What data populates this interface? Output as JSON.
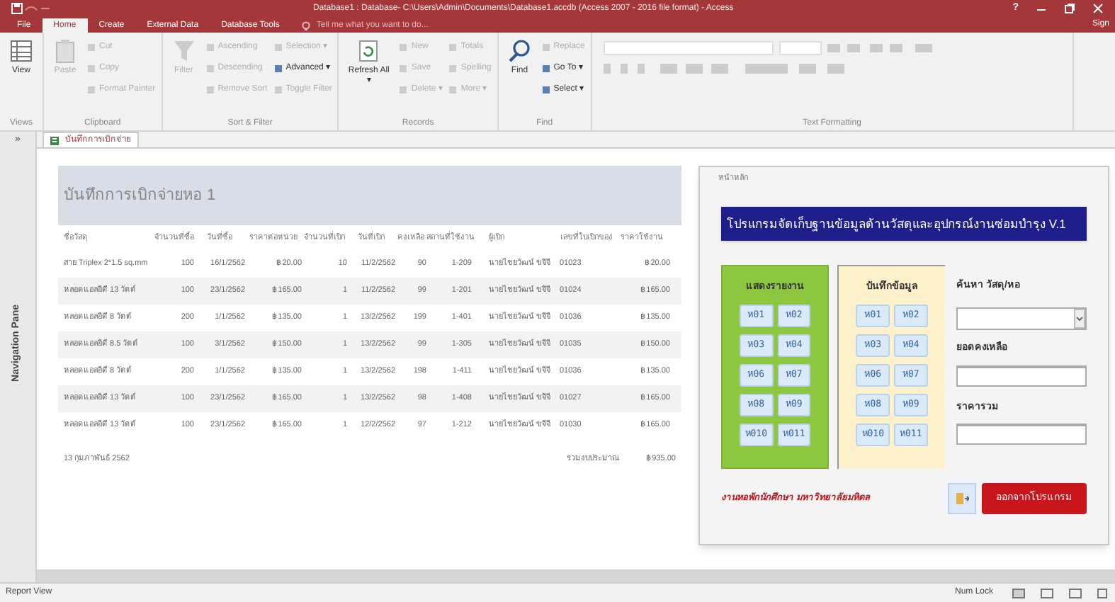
{
  "window": {
    "title": "Database1 : Database- C:\\Users\\Admin\\Documents\\Database1.accdb (Access 2007 - 2016 file format) - Access",
    "help": "?",
    "account": "Sign"
  },
  "ribbon_tabs": [
    {
      "label": "File",
      "selected": false
    },
    {
      "label": "Home",
      "selected": true
    },
    {
      "label": "Create",
      "selected": false
    },
    {
      "label": "External Data",
      "selected": false
    },
    {
      "label": "Database Tools",
      "selected": false
    }
  ],
  "tell_me": {
    "placeholder": "Tell me what you want to do..."
  },
  "ribbon_groups": [
    {
      "label": "Views",
      "columns": [
        [
          {
            "label": "View",
            "kind": "large",
            "disabled": false
          }
        ]
      ]
    },
    {
      "label": "Clipboard",
      "columns": [
        [
          {
            "label": "Paste",
            "kind": "large",
            "disabled": true
          }
        ],
        [
          {
            "label": "Cut",
            "kind": "small",
            "disabled": true
          },
          {
            "label": "Copy",
            "kind": "small",
            "disabled": true
          },
          {
            "label": "Format Painter",
            "kind": "small",
            "disabled": true
          }
        ]
      ]
    },
    {
      "label": "Sort & Filter",
      "columns": [
        [
          {
            "label": "Filter",
            "kind": "large",
            "disabled": true
          }
        ],
        [
          {
            "label": "Ascending",
            "kind": "small",
            "disabled": true
          },
          {
            "label": "Descending",
            "kind": "small",
            "disabled": true
          },
          {
            "label": "Remove Sort",
            "kind": "small",
            "disabled": true
          }
        ],
        [
          {
            "label": "Selection ▾",
            "kind": "small",
            "disabled": true
          },
          {
            "label": "Advanced ▾",
            "kind": "small",
            "disabled": false
          },
          {
            "label": "Toggle Filter",
            "kind": "small",
            "disabled": true
          }
        ]
      ]
    },
    {
      "label": "Records",
      "columns": [
        [
          {
            "label": "Refresh All ▾",
            "kind": "large",
            "disabled": false
          }
        ],
        [
          {
            "label": "New",
            "kind": "small",
            "disabled": true
          },
          {
            "label": "Save",
            "kind": "small",
            "disabled": true
          },
          {
            "label": "Delete ▾",
            "kind": "small",
            "disabled": true
          }
        ],
        [
          {
            "label": "Totals",
            "kind": "small",
            "disabled": true
          },
          {
            "label": "Spelling",
            "kind": "small",
            "disabled": true
          },
          {
            "label": "More ▾",
            "kind": "small",
            "disabled": true
          }
        ]
      ]
    },
    {
      "label": "Find",
      "columns": [
        [
          {
            "label": "Find",
            "kind": "large",
            "disabled": false
          }
        ],
        [
          {
            "label": "Replace",
            "kind": "small",
            "disabled": true
          },
          {
            "label": "Go To ▾",
            "kind": "small",
            "disabled": false
          },
          {
            "label": "Select ▾",
            "kind": "small",
            "disabled": false
          }
        ]
      ]
    },
    {
      "label": "Text Formatting"
    }
  ],
  "document_tab": {
    "label": "บันทึกการเบิกจ่าย"
  },
  "navigation_pane": {
    "label": "Navigation Pane",
    "toggle": "»"
  },
  "report": {
    "title": "บันทึกการเบิกจ่ายหอ 1",
    "columns": [
      "ชื่อวัสดุ",
      "จำนวนที่ซื้อ",
      "วันที่ซื้อ",
      "ราคาต่อหน่วย",
      "จำนวนที่เบิก",
      "วันที่เบิก",
      "คงเหลือ",
      "สถานที่ใช้งาน",
      "ผู้เบิก",
      "เลขที่ใบเบิกของ",
      "ราคาใช้งาน"
    ],
    "rows": [
      [
        "สาย Triplex 2*1.5 sq.mm",
        "100",
        "16/1/2562",
        "฿20.00",
        "10",
        "11/2/2562",
        "90",
        "1-209",
        "นายไชยวัฒน์ ขจีจี",
        "01023",
        "฿20.00"
      ],
      [
        "หลอดแอลอีดี 13 วัตต์",
        "100",
        "23/1/2562",
        "฿165.00",
        "1",
        "11/2/2562",
        "99",
        "1-201",
        "นายไชยวัฒน์ ขจีจี",
        "01024",
        "฿165.00"
      ],
      [
        "หลอดแอลอีดี 8 วัตต์",
        "200",
        "1/1/2562",
        "฿135.00",
        "1",
        "13/2/2562",
        "199",
        "1-401",
        "นายไชยวัฒน์ ขจีจี",
        "01036",
        "฿135.00"
      ],
      [
        "หลอดแอลอีดี 8.5 วัตต์",
        "100",
        "3/1/2562",
        "฿150.00",
        "1",
        "13/2/2562",
        "99",
        "1-305",
        "นายไชยวัฒน์ ขจีจี",
        "01035",
        "฿150.00"
      ],
      [
        "หลอดแอลอีดี 8 วัตต์",
        "200",
        "1/1/2562",
        "฿135.00",
        "1",
        "13/2/2562",
        "198",
        "1-411",
        "นายไชยวัฒน์ ขจีจี",
        "01036",
        "฿135.00"
      ],
      [
        "หลอดแอลอีดี 13 วัตต์",
        "100",
        "23/1/2562",
        "฿165.00",
        "1",
        "13/2/2562",
        "98",
        "1-408",
        "นายไชยวัฒน์ ขจีจี",
        "01027",
        "฿165.00"
      ],
      [
        "หลอดแอลอีดี 13 วัตต์",
        "100",
        "23/1/2562",
        "฿165.00",
        "1",
        "12/2/2562",
        "97",
        "1-212",
        "นายไชยวัฒน์ ขจีจี",
        "01030",
        "฿165.00"
      ]
    ],
    "date": "13 กุมภาพันธ์ 2562",
    "total_label": "รวมงบประมาณ",
    "total": "฿935.00"
  },
  "form": {
    "title": "หน้าหลัก",
    "banner": "โปรแกรมจัดเก็บฐานข้อมูลด้านวัสดุและอุปกรณ์งานซ่อมบำรุง V.1",
    "panels": [
      {
        "title": "แสดงรายงาน",
        "kind": "report",
        "buttons": [
          "ห01",
          "ห02",
          "ห03",
          "ห04",
          "ห06",
          "ห07",
          "ห08",
          "ห09",
          "ห010",
          "ห011"
        ]
      },
      {
        "title": "บันทึกข้อมูล",
        "kind": "entry",
        "buttons": [
          "ห01",
          "ห02",
          "ห03",
          "ห04",
          "ห06",
          "ห07",
          "ห08",
          "ห09",
          "ห010",
          "ห011"
        ]
      }
    ],
    "search_label": "ค้นหา วัสดุ/หอ",
    "balance_label": "ยอดคงเหลือ",
    "price_label": "ราคารวม",
    "credit": "งานหอพักนักศึกษา มหาวิทยาลัยมหิดล",
    "exit_button": "ออกจากโปรแกรม"
  },
  "status_bar": {
    "left": "Report View",
    "right": "Num Lock"
  }
}
